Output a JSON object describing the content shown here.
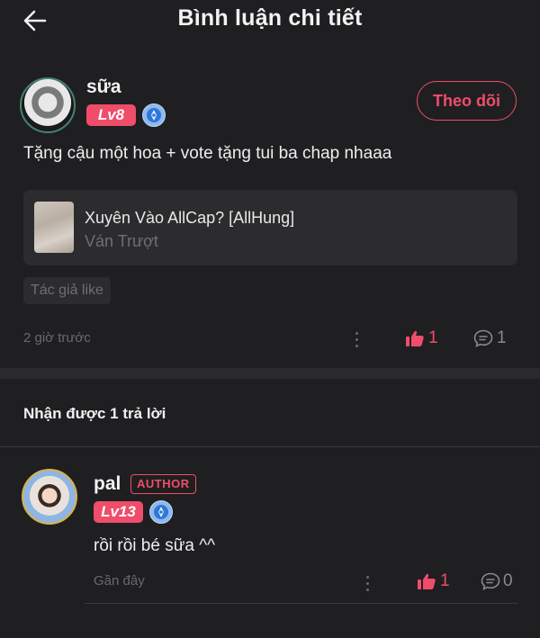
{
  "header": {
    "title": "Bình luận chi tiết",
    "back_icon": "arrow-left-icon"
  },
  "comment": {
    "username": "sữa",
    "level": "Lv8",
    "follow_label": "Theo dõi",
    "text": "Tặng cậu một hoa + vote tặng tui ba chap nhaaa",
    "story": {
      "title": "Xuyên Vào AllCap? [AllHung]",
      "author": "Ván Trượt"
    },
    "tag": "Tác giả like",
    "time": "2 giờ trước",
    "likes": "1",
    "replies": "1"
  },
  "replies_section": {
    "label": "Nhận được 1 trả lời"
  },
  "reply": {
    "username": "pal",
    "badge": "AUTHOR",
    "level": "Lv13",
    "text": "rồi rồi bé sữa ^^",
    "time": "Gần đây",
    "likes": "1",
    "replies": "0"
  },
  "colors": {
    "accent": "#ef4d6a",
    "background": "#1f1f21",
    "card": "#2c2c2e",
    "muted": "#6f6f72",
    "medal": "#2d77d8"
  }
}
